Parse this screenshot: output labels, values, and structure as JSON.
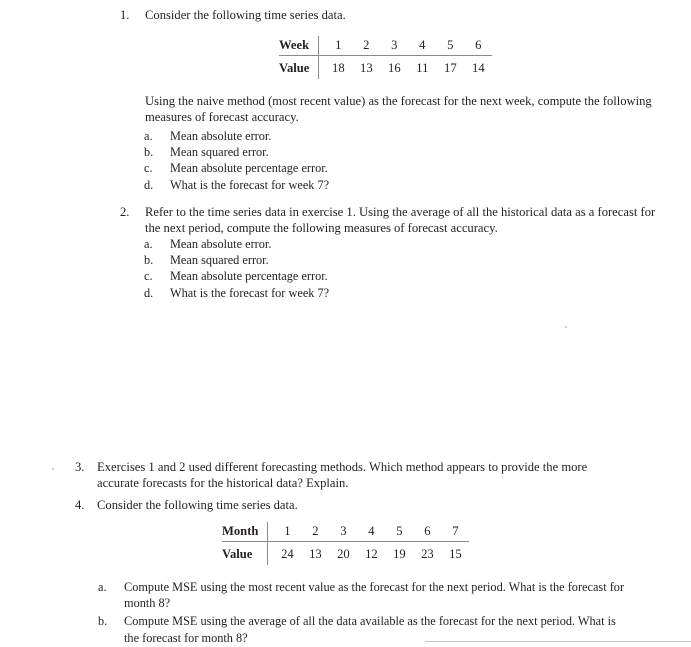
{
  "exercises": [
    {
      "number": "1.",
      "prompt": "Consider the following time series data.",
      "table": {
        "row_labels": [
          "Week",
          "Value"
        ],
        "periods": [
          "1",
          "2",
          "3",
          "4",
          "5",
          "6"
        ],
        "values": [
          "18",
          "13",
          "16",
          "11",
          "17",
          "14"
        ]
      },
      "instruction": "Using the naive method (most recent value) as the forecast for the next week, compute the following measures of forecast accuracy.",
      "subitems": [
        {
          "marker": "a.",
          "text": "Mean absolute error."
        },
        {
          "marker": "b.",
          "text": "Mean squared error."
        },
        {
          "marker": "c.",
          "text": "Mean absolute percentage error."
        },
        {
          "marker": "d.",
          "text": "What is the forecast for week 7?"
        }
      ]
    },
    {
      "number": "2.",
      "prompt": "Refer to the time series data in exercise 1. Using the average of all the historical data as a forecast for the next period, compute the following measures of forecast accuracy.",
      "subitems": [
        {
          "marker": "a.",
          "text": "Mean absolute error."
        },
        {
          "marker": "b.",
          "text": "Mean squared error."
        },
        {
          "marker": "c.",
          "text": "Mean absolute percentage error."
        },
        {
          "marker": "d.",
          "text": "What is the forecast for week 7?"
        }
      ]
    },
    {
      "number": "3.",
      "prompt": "Exercises 1 and 2 used different forecasting methods. Which method appears to provide the more accurate forecasts for the historical data? Explain."
    },
    {
      "number": "4.",
      "prompt": "Consider the following time series data.",
      "table": {
        "row_labels": [
          "Month",
          "Value"
        ],
        "periods": [
          "1",
          "2",
          "3",
          "4",
          "5",
          "6",
          "7"
        ],
        "values": [
          "24",
          "13",
          "20",
          "12",
          "19",
          "23",
          "15"
        ]
      },
      "subitems": [
        {
          "marker": "a.",
          "text": "Compute MSE using the most recent value as the forecast for the next period. What is the forecast for month 8?"
        },
        {
          "marker": "b.",
          "text": "Compute MSE using the average of all the data available as the forecast for the next period. What is the forecast for month 8?"
        }
      ]
    }
  ],
  "colors": {
    "text": "#231f20",
    "rule": "#8a8a8a",
    "artifact": "#c9c9c9"
  }
}
